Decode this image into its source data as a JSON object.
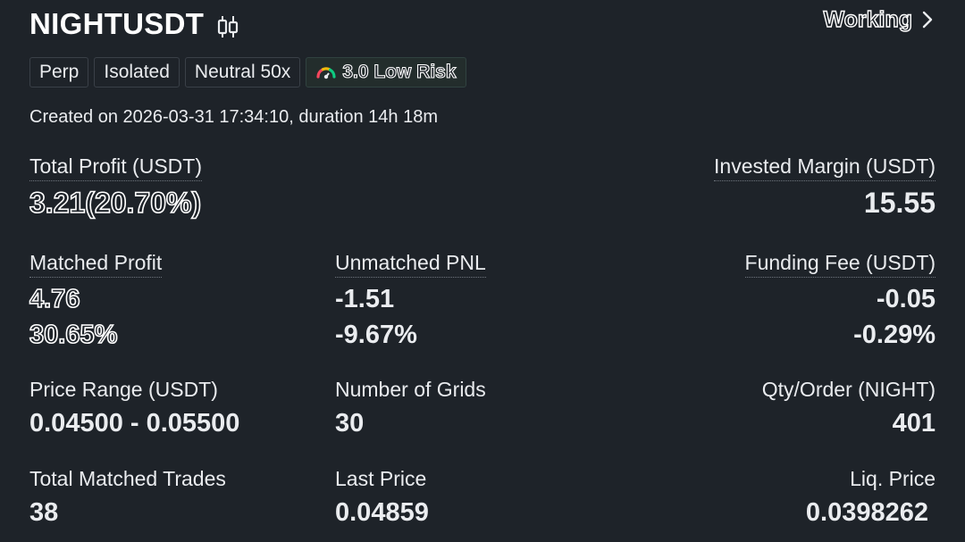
{
  "header": {
    "symbol": "NIGHTUSDT",
    "status": "Working"
  },
  "tags": {
    "perp": "Perp",
    "margin_mode": "Isolated",
    "direction_leverage": "Neutral 50x",
    "risk": "3.0 Low Risk"
  },
  "created_text": "Created on 2026-03-31 17:34:10, duration 14h 18m",
  "total_profit": {
    "label": "Total Profit (USDT)",
    "value": "3.21(20.70%)"
  },
  "invested_margin": {
    "label": "Invested Margin (USDT)",
    "value": "15.55"
  },
  "matched_profit": {
    "label": "Matched Profit",
    "value": "4.76",
    "percent": "30.65%"
  },
  "unmatched_pnl": {
    "label": "Unmatched PNL",
    "value": "-1.51",
    "percent": "-9.67%"
  },
  "funding_fee": {
    "label": "Funding Fee (USDT)",
    "value": "-0.05",
    "percent": "-0.29%"
  },
  "price_range": {
    "label": "Price Range (USDT)",
    "value": "0.04500 - 0.05500"
  },
  "number_of_grids": {
    "label": "Number of Grids",
    "value": "30"
  },
  "qty_order": {
    "label": "Qty/Order (NIGHT)",
    "value": "401"
  },
  "total_matched_trades": {
    "label": "Total Matched Trades",
    "value": "38"
  },
  "last_price": {
    "label": "Last Price",
    "value": "0.04859"
  },
  "liq_price": {
    "label": "Liq. Price",
    "value": "0.0398262"
  },
  "icons": {
    "chart": "candlestick-chart-icon",
    "chevron": "chevron-right-icon",
    "gauge": "risk-gauge-icon"
  },
  "colors": {
    "background": "#1e2329",
    "text": "#eaecef",
    "tag_border": "#3a4048",
    "risk_tag_bg": "#232d2c"
  }
}
